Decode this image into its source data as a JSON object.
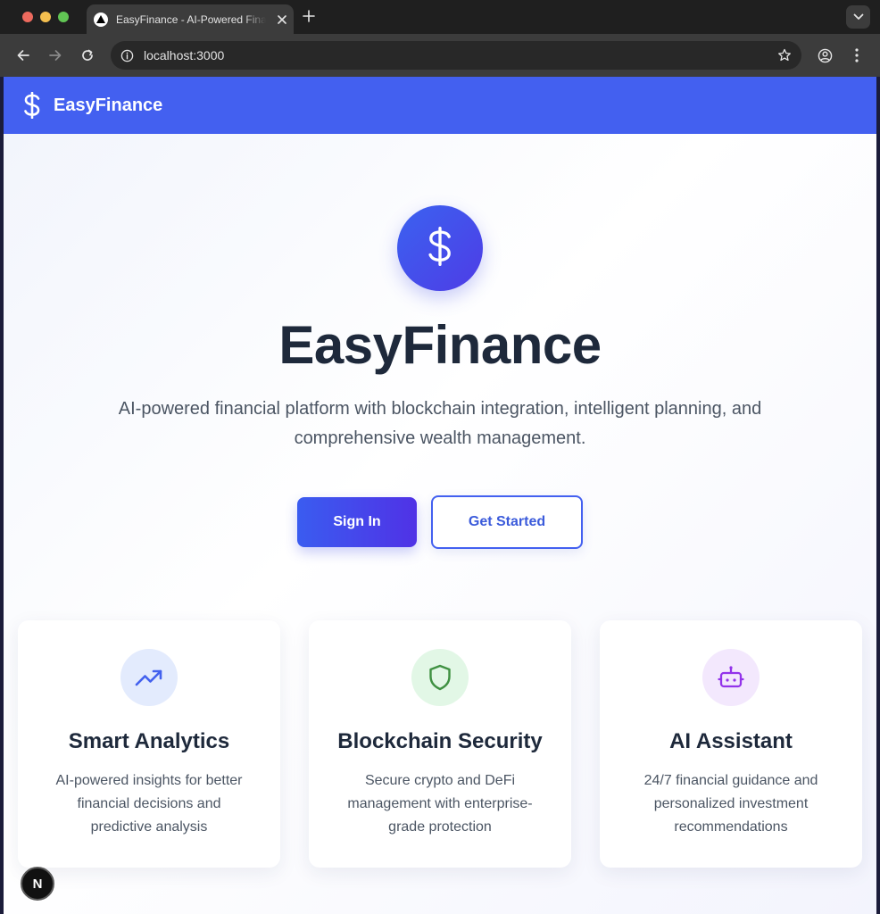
{
  "browser": {
    "tab_title": "EasyFinance - AI-Powered Finance",
    "tab_favicon": "nextjs-triangle-icon",
    "url": "localhost:3000",
    "icons": [
      "back-arrow-icon",
      "forward-arrow-icon",
      "reload-icon",
      "site-info-icon",
      "bookmark-star-icon",
      "profile-icon",
      "kebab-menu-icon",
      "tab-search-chevron-icon",
      "new-tab-plus-icon",
      "close-tab-icon"
    ]
  },
  "appbar": {
    "brand": "EasyFinance",
    "icon": "dollar-sign-icon",
    "color": "#4360f0"
  },
  "hero": {
    "icon": "dollar-sign-icon",
    "title": "EasyFinance",
    "subtitle": "AI-powered financial platform with blockchain integration, intelligent planning, and comprehensive wealth management.",
    "sign_in_label": "Sign In",
    "get_started_label": "Get Started"
  },
  "features": [
    {
      "icon": "trending-up-icon",
      "icon_color": "#4361ee",
      "icon_bg": "#e3ebfd",
      "title": "Smart Analytics",
      "description": "AI-powered insights for better financial decisions and predictive analysis"
    },
    {
      "icon": "shield-icon",
      "icon_color": "#3f9142",
      "icon_bg": "#e2f7e6",
      "title": "Blockchain Security",
      "description": "Secure crypto and DeFi management with enterprise-grade protection"
    },
    {
      "icon": "bot-icon",
      "icon_color": "#9333ea",
      "icon_bg": "#f3e8fd",
      "title": "AI Assistant",
      "description": "24/7 financial guidance and personalized investment recommendations"
    }
  ],
  "dev_badge": {
    "letter": "N",
    "icon": "nextjs-devtools-icon"
  }
}
